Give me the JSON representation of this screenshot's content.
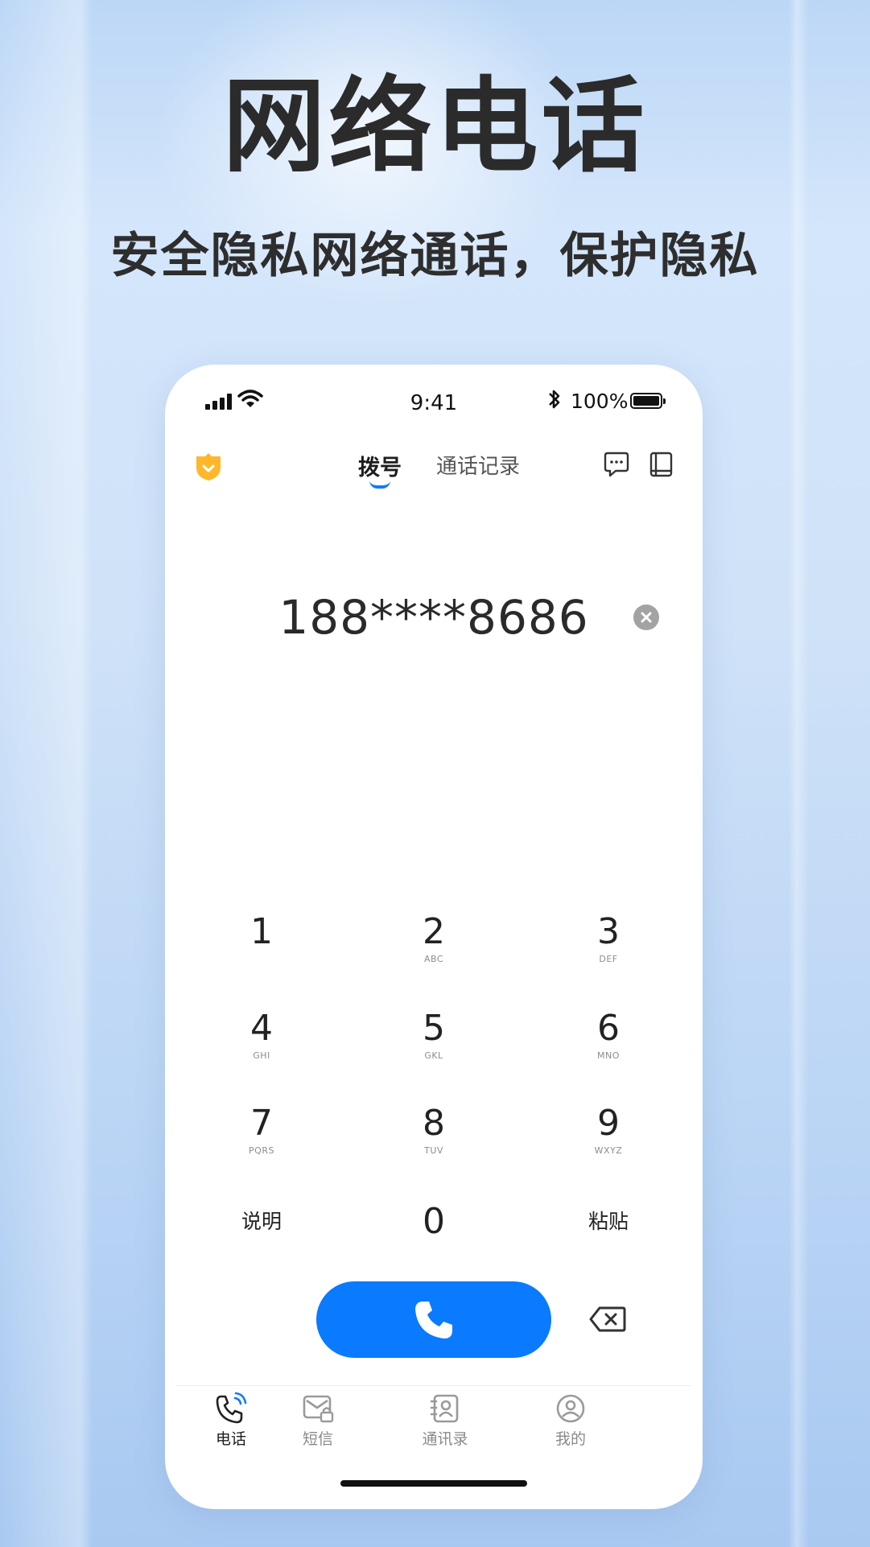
{
  "promo": {
    "headline": "网络电话",
    "subline": "安全隐私网络通话，保护隐私"
  },
  "status_bar": {
    "time": "9:41",
    "battery": "100%"
  },
  "header": {
    "tabs": [
      {
        "label": "拨号",
        "active": true
      },
      {
        "label": "通话记录",
        "active": false
      }
    ]
  },
  "dialer": {
    "number": "188****8686",
    "keys": [
      {
        "digit": "1",
        "letters": ""
      },
      {
        "digit": "2",
        "letters": "ABC"
      },
      {
        "digit": "3",
        "letters": "DEF"
      },
      {
        "digit": "4",
        "letters": "GHI"
      },
      {
        "digit": "5",
        "letters": "GKL"
      },
      {
        "digit": "6",
        "letters": "MNO"
      },
      {
        "digit": "7",
        "letters": "PQRS"
      },
      {
        "digit": "8",
        "letters": "TUV"
      },
      {
        "digit": "9",
        "letters": "WXYZ"
      }
    ],
    "help_label": "说明",
    "zero": "0",
    "paste_label": "粘贴"
  },
  "bottom_nav": [
    {
      "label": "电话",
      "icon": "phone-icon",
      "active": true
    },
    {
      "label": "短信",
      "icon": "sms-lock-icon",
      "active": false
    },
    {
      "label": "通讯录",
      "icon": "contacts-icon",
      "active": false
    },
    {
      "label": "我的",
      "icon": "profile-icon",
      "active": false
    }
  ],
  "colors": {
    "accent": "#0a7aff",
    "shield": "#ffb72a",
    "active_text": "#1d1d1d",
    "inactive_text": "#8a8a8a"
  }
}
